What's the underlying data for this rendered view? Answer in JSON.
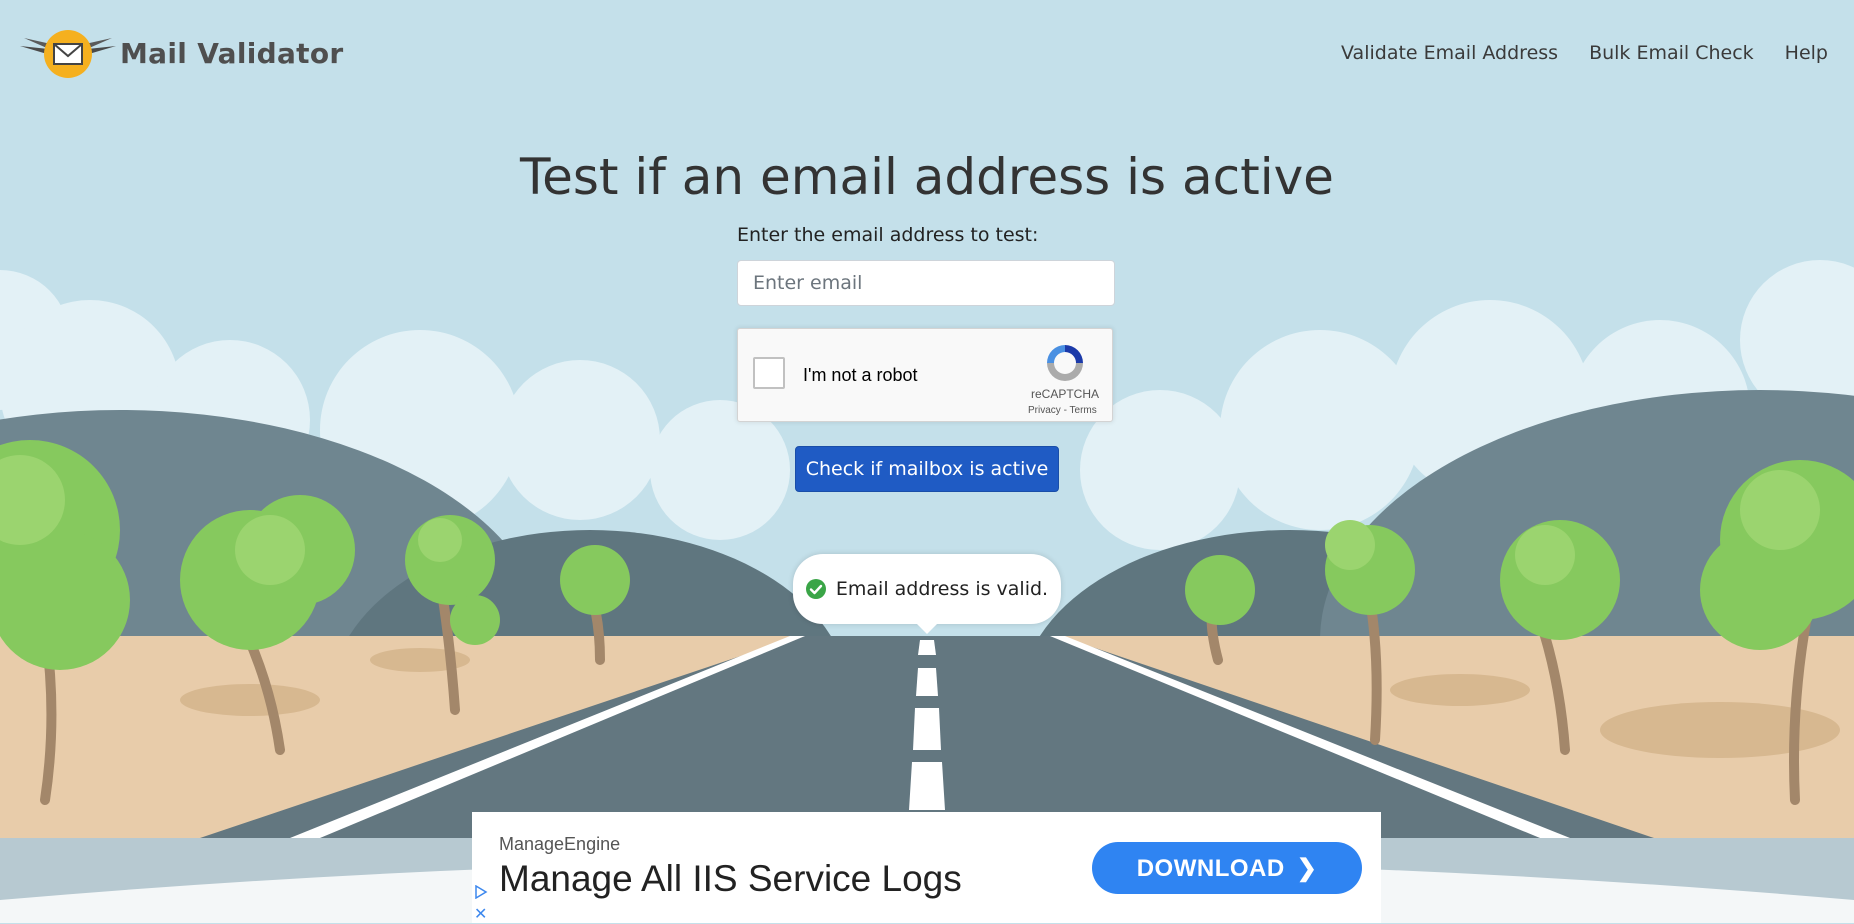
{
  "header": {
    "logo_text": "Mail Validator",
    "nav": [
      {
        "label": "Validate Email Address"
      },
      {
        "label": "Bulk Email Check"
      },
      {
        "label": "Help"
      }
    ]
  },
  "main": {
    "title": "Test if an email address is active",
    "field_label": "Enter the email address to test:",
    "email_placeholder": "Enter email",
    "email_value": "",
    "captcha": {
      "label": "I'm not a robot",
      "brand": "reCAPTCHA",
      "privacy": "Privacy",
      "separator": " - ",
      "terms": "Terms",
      "checked": false
    },
    "submit_label": "Check if mailbox is active",
    "result": {
      "text": "Email address is valid.",
      "status": "valid",
      "icon": "check-circle-icon",
      "color": "#3aa547"
    }
  },
  "ad": {
    "brand": "ManageEngine",
    "headline": "Manage All IIS Service Logs",
    "cta": "DOWNLOAD",
    "cta_icon": "chevron-right-icon",
    "close_icon": "close-icon",
    "adchoices_icon": "adchoices-icon",
    "cta_color": "#2f84f2"
  },
  "colors": {
    "sky": "#c4e0ea",
    "button": "#1f5bc4",
    "road": "#637780",
    "sand": "#e8ccaa",
    "tree": "#86c95e"
  }
}
